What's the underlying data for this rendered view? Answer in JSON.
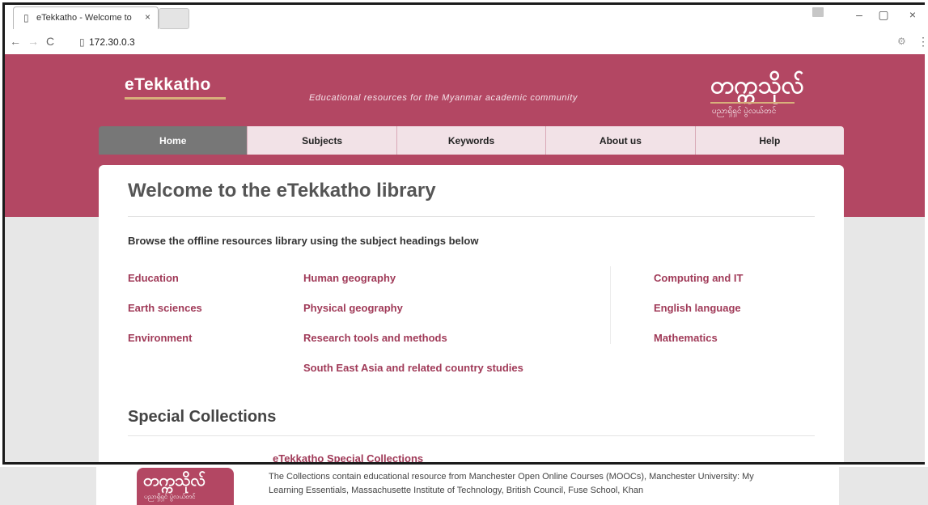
{
  "browser": {
    "tab_title": "eTekkatho - Welcome to",
    "tab_close": "×",
    "address": "172.30.0.3",
    "back": "←",
    "forward": "→",
    "reload": "C",
    "minimize": "–",
    "maximize": "▢",
    "close": "×",
    "menu": "⋮",
    "extension": "⚙"
  },
  "header": {
    "brand": "eTekkatho",
    "tagline": "Educational resources for the Myanmar academic community",
    "logo_text": "တက္ကသိုလ်",
    "logo_subtext": "ပညာရှိရှင် ပွဲလယ်တင်"
  },
  "nav": {
    "items": [
      {
        "label": "Home",
        "active": true
      },
      {
        "label": "Subjects"
      },
      {
        "label": "Keywords"
      },
      {
        "label": "About us"
      },
      {
        "label": "Help"
      }
    ]
  },
  "main": {
    "title": "Welcome to the eTekkatho library",
    "intro": "Browse the offline resources library using the subject headings below",
    "subjects_col1": [
      "Education",
      "Earth sciences",
      "Environment"
    ],
    "subjects_col2": [
      "Human geography",
      "Physical geography",
      "Research tools and methods",
      "South East Asia and related country studies"
    ],
    "subjects_col3": [
      "Computing and IT",
      "English language",
      "Mathematics"
    ],
    "special_title": "Special Collections",
    "special_item_title": "eTekkatho Special Collections",
    "special_item_desc": "The Collections contain educational resource from Manchester Open Online Courses (MOOCs), Manchester University: My Learning Essentials, Massachusette Institute of Technology, British Council, Fuse School, Khan"
  },
  "colors": {
    "brand": "#b34763",
    "link": "#a03a58",
    "nav_active": "#777777",
    "nav_bg": "#f2e2e7"
  }
}
